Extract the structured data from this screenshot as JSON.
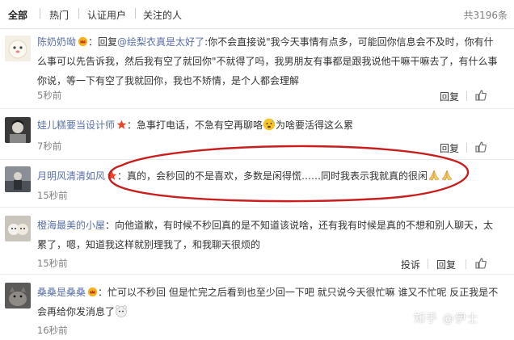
{
  "tabs": {
    "all": "全部",
    "hot": "热门",
    "verified": "认证用户",
    "following": "关注的人"
  },
  "total": "共3196条",
  "actions": {
    "reply": "回复",
    "report": "投诉"
  },
  "comments": [
    {
      "user": "陈奶奶呦",
      "colon": "：",
      "reply_prefix": "回复",
      "mention": "@绘梨衣真是太好了",
      "text": ":你不会直接说\"我今天事情有点多，可能回你信息会不及时，你有什么事可以先告诉我，然后我有空了就回你\"不就得了吗，我男朋友有事都是跟我说他干嘛干嘛去了，有什么事你说，等一下有空了我就回你，我也不矫情，是个人都会理解",
      "time": "5秒前"
    },
    {
      "user": "娃儿糕要当设计师",
      "text_before": "：急事打电话，不急有空再聊咯",
      "text_after": "为啥要活得这么累",
      "time": "7秒前"
    },
    {
      "user": "月明风清清如风",
      "text": "：真的，会秒回的不是喜欢，多数是闲得慌……同时我表示我就真的很闲",
      "time": "15秒前"
    },
    {
      "user": "橙海最美的小屋",
      "text": "：向他道歉，有时候不秒回真的是不知道该说啥，还有我有时候是真的不想和别人聊天，太累了，嗯，知道我这样就别理我了，和我聊天很烦的",
      "time": "15秒前"
    },
    {
      "user": "桑桑是桑桑",
      "text": "：忙可以不秒回 但是忙完之后看到也至少回一下吧 就只说今天很忙嘛 谁又不忙呢 反正我是不会再给你发消息了",
      "time": "16秒前"
    }
  ],
  "watermark": "知乎 @伊士",
  "colors": {
    "link": "#5a6fa8",
    "annotation_circle": "#c81e1e",
    "gold_badge": "#f5b21a",
    "red_star": "#e8442a"
  },
  "icons": [
    "gold-crown-badge-icon",
    "red-star-badge-icon",
    "thumbs-up-icon",
    "sweat-face-emoji-icon",
    "praying-hands-emoji-icon",
    "bear-face-emoji-icon"
  ]
}
